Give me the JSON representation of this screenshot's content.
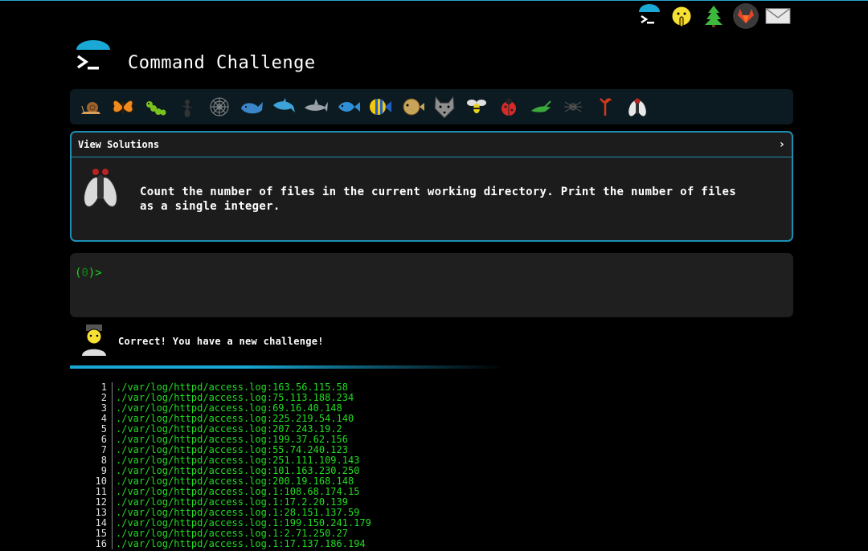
{
  "app": {
    "title": "Command Challenge"
  },
  "top_icons": [
    "terminal-logo-icon",
    "shushing-face-icon",
    "christmas-tree-icon",
    "gitlab-icon",
    "envelope-icon"
  ],
  "levels": [
    "snail-icon",
    "butterfly-icon",
    "caterpillar-icon",
    "ant-icon",
    "spider-web-icon",
    "whale-icon",
    "dolphin-icon",
    "shark-icon",
    "fish-icon",
    "tropical-fish-icon",
    "blowfish-icon",
    "wolf-icon",
    "bee-icon",
    "ladybug-icon",
    "cricket-icon",
    "spider-icon",
    "scorpion-icon",
    "fly-icon"
  ],
  "challenge": {
    "solutions_label": "View Solutions",
    "chevron": "›",
    "text": "Count the number of files in the current working directory. Print the number of files as a single integer."
  },
  "terminal": {
    "prompt_open": "(",
    "prompt_num": "0",
    "prompt_close": ")>"
  },
  "message": "Correct! You have a new challenge!",
  "output": [
    {
      "n": "1",
      "t": "./var/log/httpd/access.log:163.56.115.58"
    },
    {
      "n": "2",
      "t": "./var/log/httpd/access.log:75.113.188.234"
    },
    {
      "n": "3",
      "t": "./var/log/httpd/access.log:69.16.40.148"
    },
    {
      "n": "4",
      "t": "./var/log/httpd/access.log:225.219.54.140"
    },
    {
      "n": "5",
      "t": "./var/log/httpd/access.log:207.243.19.2"
    },
    {
      "n": "6",
      "t": "./var/log/httpd/access.log:199.37.62.156"
    },
    {
      "n": "7",
      "t": "./var/log/httpd/access.log:55.74.240.123"
    },
    {
      "n": "8",
      "t": "./var/log/httpd/access.log:251.111.109.143"
    },
    {
      "n": "9",
      "t": "./var/log/httpd/access.log:101.163.230.250"
    },
    {
      "n": "10",
      "t": "./var/log/httpd/access.log:200.19.168.148"
    },
    {
      "n": "11",
      "t": "./var/log/httpd/access.log.1:108.68.174.15"
    },
    {
      "n": "12",
      "t": "./var/log/httpd/access.log.1:17.2.20.139"
    },
    {
      "n": "13",
      "t": "./var/log/httpd/access.log.1:28.151.137.59"
    },
    {
      "n": "14",
      "t": "./var/log/httpd/access.log.1:199.150.241.179"
    },
    {
      "n": "15",
      "t": "./var/log/httpd/access.log.1:2.71.250.27"
    },
    {
      "n": "16",
      "t": "./var/log/httpd/access.log.1:17.137.186.194"
    }
  ]
}
